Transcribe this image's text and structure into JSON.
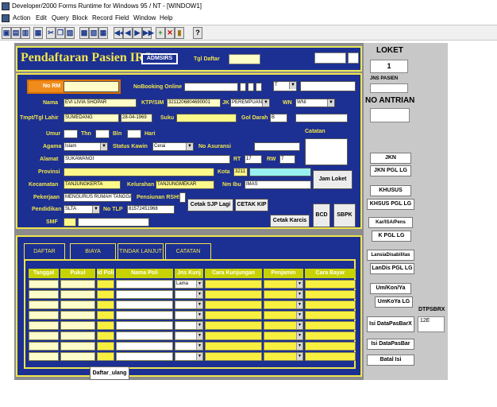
{
  "window": {
    "title": "Developer/2000 Forms Runtime for Windows 95 / NT - [WINDOW1]",
    "menu": [
      "Action",
      "Edit",
      "Query",
      "Block",
      "Record",
      "Field",
      "Window",
      "Help"
    ]
  },
  "toolbar": {
    "nav": [
      "◀◀",
      "◀",
      "▶",
      "▶▶"
    ],
    "record": [
      "+",
      "✕",
      "?"
    ]
  },
  "header": {
    "title": "Pendaftaran Pasien IRJ",
    "admsirs_button": "ADMSIRS",
    "tgl_daftar_label": "Tgl Daftar"
  },
  "patient": {
    "no_rm_label": "No RM",
    "nobooking_label": "NoBooking Online",
    "t_select": "T",
    "nama_label": "Nama",
    "nama_value": "EVI LIVIA SHOPAR",
    "ktp_label": "KTP/SIM",
    "ktp_value": "3211206804690001",
    "jk_label": "JK",
    "jk_value": "PEREMPUAN",
    "wn_label": "WN",
    "wn_value": "WNI",
    "tempat_label": "Tmpt/Tgl Lahir",
    "tempat_value": "SUMEDANG",
    "tgl_lahir_value": "28-04-1969",
    "suku_label": "Suku",
    "gol_darah_label": "Gol Darah",
    "gol_darah_value": "B",
    "catatan_label": "Catatan",
    "umur_label": "Umur",
    "thn_label": "Thn",
    "bln_label": "Bln",
    "hari_label": "Hari",
    "agama_label": "Agama",
    "agama_value": "Islam",
    "status_label": "Status Kawin",
    "status_value": "Cerai",
    "asuransi_label": "No Asuransi",
    "alamat_label": "Alamat",
    "alamat_value": "SUKAWANGI",
    "rt_label": "RT",
    "rt_value": "17",
    "rw_label": "RW",
    "rw_value": "7",
    "provinsi_label": "Provinsi",
    "kota_label": "Kota",
    "kota_value": "3211",
    "kecamatan_label": "Kecamatan",
    "kecamatan_value": "TANJUNGKERTA",
    "kelurahan_label": "Kelurahan",
    "kelurahan_value": "TANJUNGMEKAR",
    "nm_ibu_label": "Nm Ibu",
    "nm_ibu_value": "IMAS",
    "pekerjaan_label": "Pekerjaan",
    "pekerjaan_value": "MENGURUS RUMAH TANGGA",
    "pensiunan_label": "Pensiunan RSHS",
    "pendidikan_label": "Pendidikan",
    "pendidikan_value": "SLTA",
    "no_tlp_label": "No TLP",
    "no_tlp_value": "81572451968",
    "smf_label": "SMF",
    "jam_loket_button": "Jam Loket",
    "cetak_sjp_button": "Cetak SJP Lagi",
    "cetak_kip_button": "CETAK KIP",
    "cetak_karcis_button": "Cetak Karcis",
    "bcd_button": "BCD",
    "sbpk_button": "SBPK"
  },
  "tabs": [
    "DAFTAR",
    "BIAYA",
    "TINDAK LANJUT",
    "CATATAN"
  ],
  "grid": {
    "headers": [
      "Tanggal",
      "Pukul",
      "Id Poli",
      "Nama Poli",
      "Jns Kunj",
      "Cara Kunjungan",
      "Penjamin",
      "Cara Bayar"
    ],
    "first_row_jns": "Lama",
    "row_count": 8
  },
  "daftar_ulang_button": "Daftar_ulang",
  "right": {
    "loket_label": "LOKET",
    "loket_value": "1",
    "jns_pasien_label": "JNS PASIEN",
    "no_antrian_label": "NO ANTRIAN",
    "buttons": [
      {
        "label": "JKN"
      },
      {
        "label": "JKN PGL LG"
      },
      {
        "label": "KHUSUS"
      },
      {
        "label": "KHSUS PGL LG"
      },
      {
        "label": "Kar/ISA/Pens"
      },
      {
        "label": "K PGL LG"
      },
      {
        "label": "LansiaDisabilitas"
      },
      {
        "label": "LanDis PGL LG"
      },
      {
        "label": "Um/Kon/Ya"
      },
      {
        "label": "UmKoYa LG"
      },
      {
        "label": "Isi DataPasBarX"
      },
      {
        "label": "Isi DataPasBar"
      },
      {
        "label": "Batal Isi"
      }
    ],
    "dtpsbrx_label": "DTPSBRX",
    "dtpsbrx_value": "12E"
  }
}
